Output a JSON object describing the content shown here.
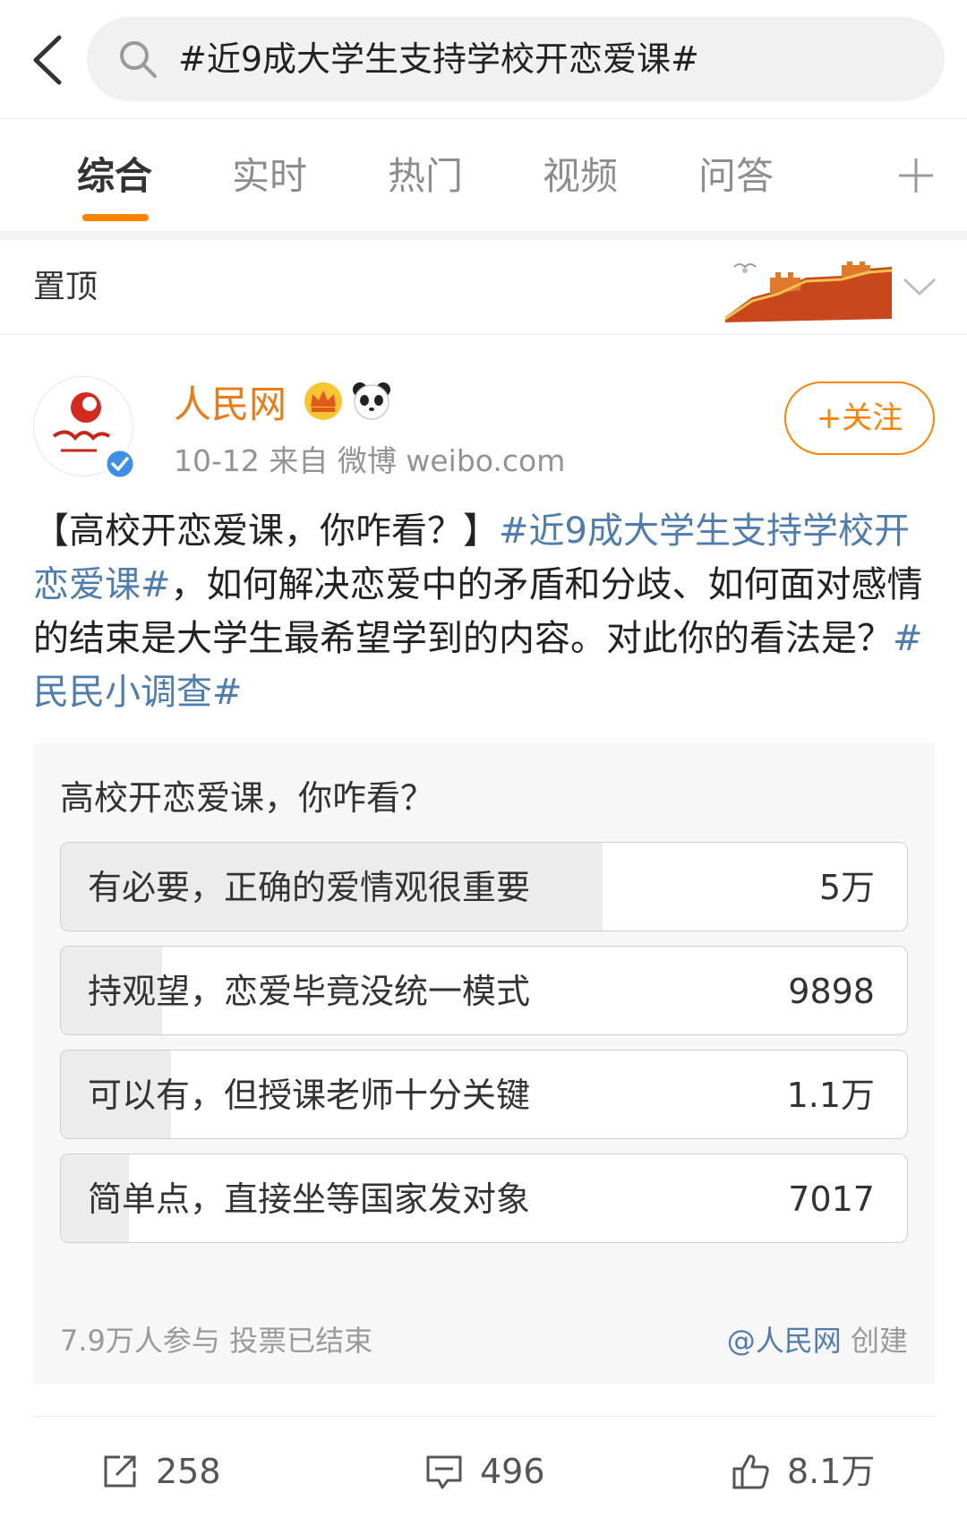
{
  "search": {
    "query": "#近9成大学生支持学校开恋爱课#"
  },
  "tabs": [
    {
      "label": "综合"
    },
    {
      "label": "实时"
    },
    {
      "label": "热门"
    },
    {
      "label": "视频"
    },
    {
      "label": "问答"
    }
  ],
  "pinned": {
    "label": "置顶"
  },
  "post": {
    "author": "人民网",
    "meta": "10-12  来自 微博 weibo.com",
    "follow_label": "+关注",
    "text": {
      "part1": "【高校开恋爱课，你咋看？】",
      "tag1": "#近9成大学生支持学校开恋爱课#",
      "part2": "，如何解决恋爱中的矛盾和分歧、如何面对感情的结束是大学生最希望学到的内容。对此你的看法是？",
      "tag2": "#民民小调查#"
    }
  },
  "poll": {
    "title": "高校开恋爱课，你咋看？",
    "options": [
      {
        "label": "有必要，正确的爱情观很重要",
        "count": "5万",
        "fraction": 0.64
      },
      {
        "label": "持观望，恋爱毕竟没统一模式",
        "count": "9898",
        "fraction": 0.12
      },
      {
        "label": "可以有，但授课老师十分关键",
        "count": "1.1万",
        "fraction": 0.13
      },
      {
        "label": "简单点，直接坐等国家发对象",
        "count": "7017",
        "fraction": 0.08
      }
    ],
    "participants": "7.9万人参与",
    "status": "投票已结束",
    "creator": "@人民网",
    "created_label": "创建"
  },
  "actions": {
    "reposts": "258",
    "comments": "496",
    "likes": "8.1万"
  },
  "colors": {
    "accent": "#ff8200",
    "author": "#ec7b15",
    "link": "#507daf",
    "poll_bg": "#f7f7f7",
    "poll_fill": "#ececec"
  },
  "icons": [
    "back-arrow-icon",
    "search-icon",
    "plus-icon",
    "chevron-down-icon",
    "crown-icon",
    "panda-icon",
    "verified-icon",
    "repost-icon",
    "comment-icon",
    "like-icon"
  ]
}
